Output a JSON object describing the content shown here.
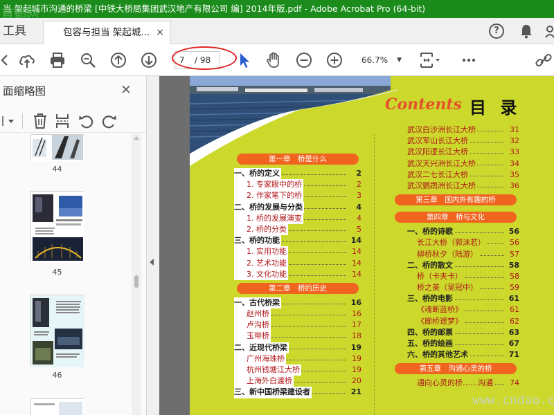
{
  "window": {
    "title": "当 架起城市沟通的桥梁 [中铁大桥局集团武汉地产有限公司 编] 2014年版.pdf - Adobe Acrobat Pro (64-bit)",
    "watermark_top": "首都网"
  },
  "tabs": {
    "tools_label": "工具",
    "doc_tab_label": "包容与担当 架起城...",
    "close_glyph": "×",
    "help_glyph": "?"
  },
  "toolbar": {
    "current_page": "7",
    "total_pages": "/ 98",
    "zoom": "66.7%",
    "icons": [
      "upload-icon",
      "print-icon",
      "zoom-search-icon",
      "prev-page-icon",
      "next-page-icon",
      "pointer-icon",
      "hand-icon",
      "zoom-out-icon",
      "zoom-in-icon",
      "fit-page-icon",
      "more-icon",
      "share-link-icon"
    ]
  },
  "left_panel": {
    "title": "面缩略图",
    "close_glyph": "×",
    "thumbnails": [
      {
        "num": "44"
      },
      {
        "num": "45"
      },
      {
        "num": "46"
      }
    ]
  },
  "document": {
    "heading_en": "Contents",
    "heading_cn": "目 录",
    "watermark": "www.cndao.com",
    "left_column": [
      {
        "kind": "chapter",
        "text": "第一章　桥是什么"
      },
      {
        "kind": "main",
        "text": "一、桥的定义",
        "page": "2"
      },
      {
        "kind": "sub",
        "text": "1. 专家眼中的桥",
        "page": "2"
      },
      {
        "kind": "sub",
        "text": "2. 作家笔下的桥",
        "page": "3"
      },
      {
        "kind": "main",
        "text": "二、桥的发展与分类",
        "page": "4"
      },
      {
        "kind": "sub",
        "text": "1. 桥的发展演变",
        "page": "4"
      },
      {
        "kind": "sub",
        "text": "2. 桥的分类",
        "page": "5"
      },
      {
        "kind": "main",
        "text": "三、桥的功能",
        "page": "14"
      },
      {
        "kind": "sub",
        "text": "1. 实用功能",
        "page": "14"
      },
      {
        "kind": "sub",
        "text": "2. 艺术功能",
        "page": "14"
      },
      {
        "kind": "sub",
        "text": "3. 文化功能",
        "page": "14"
      },
      {
        "kind": "chapter",
        "text": "第二章　桥的历史"
      },
      {
        "kind": "main",
        "text": "一、古代桥梁",
        "page": "16"
      },
      {
        "kind": "sub",
        "text": "赵州桥",
        "page": "16"
      },
      {
        "kind": "sub",
        "text": "卢沟桥",
        "page": "17"
      },
      {
        "kind": "sub",
        "text": "玉带桥",
        "page": "18"
      },
      {
        "kind": "main",
        "text": "二、近现代桥梁",
        "page": "19"
      },
      {
        "kind": "sub",
        "text": "广州海珠桥",
        "page": "19"
      },
      {
        "kind": "sub",
        "text": "杭州钱塘江大桥",
        "page": "19"
      },
      {
        "kind": "sub",
        "text": "上海外白渡桥",
        "page": "20"
      },
      {
        "kind": "main",
        "text": "三、新中国桥梁建设者",
        "page": "21"
      }
    ],
    "right_column": [
      {
        "kind": "sub",
        "text": "武汉白沙洲长江大桥",
        "page": "31"
      },
      {
        "kind": "sub",
        "text": "武汉军山长江大桥",
        "page": "32"
      },
      {
        "kind": "sub",
        "text": "武汉阳逻长江大桥",
        "page": "33"
      },
      {
        "kind": "sub",
        "text": "武汉天兴洲长江大桥",
        "page": "34"
      },
      {
        "kind": "sub",
        "text": "武汉二七长江大桥",
        "page": "35"
      },
      {
        "kind": "sub",
        "text": "武汉鹦鹉洲长江大桥",
        "page": "36"
      },
      {
        "kind": "chapter",
        "text": "第三章　国内外有趣的桥"
      },
      {
        "kind": "chapter",
        "text": "第四章　桥与文化"
      },
      {
        "kind": "main",
        "text": "一、桥的诗歌",
        "page": "56"
      },
      {
        "kind": "subind",
        "text": "长江大桥（郭沫若）",
        "page": "56"
      },
      {
        "kind": "subind",
        "text": "柳桥秋夕（陆游）",
        "page": "57"
      },
      {
        "kind": "main",
        "text": "二、桥的散文",
        "page": "58"
      },
      {
        "kind": "subind",
        "text": "桥（卡夫卡）",
        "page": "58"
      },
      {
        "kind": "subind",
        "text": "桥之美（吴冠中）",
        "page": "59"
      },
      {
        "kind": "main",
        "text": "三、桥的电影",
        "page": "61"
      },
      {
        "kind": "subind",
        "text": "《魂断蓝桥》",
        "page": "61"
      },
      {
        "kind": "subind",
        "text": "《廊桥遗梦》",
        "page": "62"
      },
      {
        "kind": "main",
        "text": "四、桥的邮票",
        "page": "63"
      },
      {
        "kind": "main",
        "text": "五、桥的绘画",
        "page": "67"
      },
      {
        "kind": "main",
        "text": "六、桥的其他艺术",
        "page": "71"
      },
      {
        "kind": "chapter",
        "text": "第五章　沟通心灵的桥"
      },
      {
        "kind": "subind",
        "text": "通向心灵的桥……沟通",
        "page": "74"
      }
    ]
  }
}
